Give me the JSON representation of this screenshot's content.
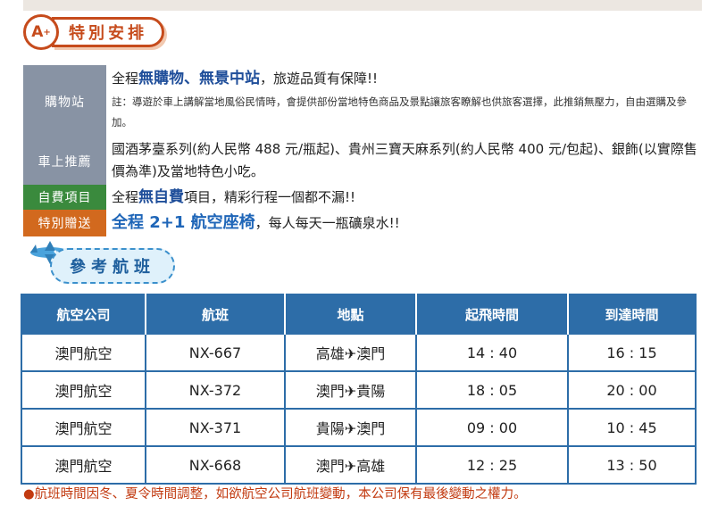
{
  "sections": {
    "special": {
      "badge_letter": "A",
      "badge_sup": "+",
      "title": "特別安排"
    },
    "flights": {
      "title": "參考航班"
    }
  },
  "info": {
    "shopping_label": "購物站",
    "shopping_prefix": "全程",
    "shopping_highlight": "無購物、無景中站",
    "shopping_suffix": "，旅遊品質有保障!!",
    "shopping_note": "註：導遊於車上講解當地風俗民情時，會提供部份當地特色商品及景點讓旅客瞭解也供旅客選擇，此推銷無壓力，自由選購及參加。",
    "recommend_label": "車上推薦",
    "recommend_text": "國酒茅臺系列(約人民幣 488 元/瓶起)、貴州三寶天麻系列(約人民幣 400 元/包起)、銀飾(以實際售價為準)及當地特色小吃。",
    "selfpay_label": "自費項目",
    "selfpay_prefix": "全程",
    "selfpay_highlight": "無自費",
    "selfpay_suffix": "項目，精彩行程一個都不漏!!",
    "gift_label": "特別贈送",
    "gift_highlight": "全程 2+1 航空座椅",
    "gift_suffix": "，每人每天一瓶礦泉水!!"
  },
  "flight_table": {
    "headers": [
      "航空公司",
      "航班",
      "地點",
      "起飛時間",
      "到達時間"
    ],
    "rows": [
      [
        "澳門航空",
        "NX-667",
        "高雄✈澳門",
        "14 : 40",
        "16 : 15"
      ],
      [
        "澳門航空",
        "NX-372",
        "澳門✈貴陽",
        "18 : 05",
        "20 : 00"
      ],
      [
        "澳門航空",
        "NX-371",
        "貴陽✈澳門",
        "09 : 00",
        "10 : 45"
      ],
      [
        "澳門航空",
        "NX-668",
        "澳門✈高雄",
        "12 : 25",
        "13 : 50"
      ]
    ]
  },
  "footer_note": "●航班時間因冬、夏令時間調整，如欲航空公司航班變動，本公司保有最後變動之權力。",
  "colors": {
    "accent_orange": "#c64b1c",
    "table_blue": "#2d6da8",
    "label_gray": "#8893a4",
    "label_green": "#3a8a3d",
    "label_orange": "#d2691e"
  }
}
